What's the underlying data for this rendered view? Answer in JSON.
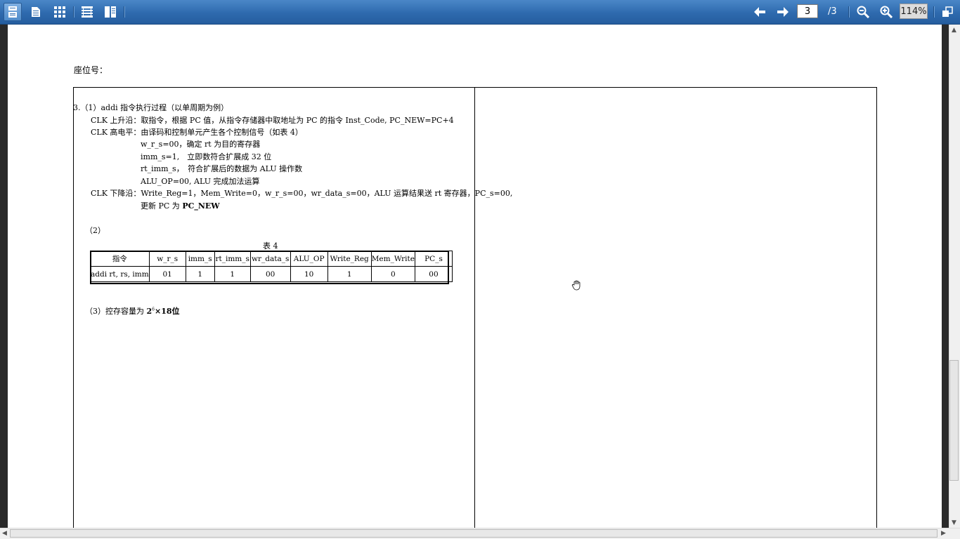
{
  "toolbar": {
    "page_current": "3",
    "page_total": "/3",
    "zoom": "114%",
    "icons": [
      "single-page-view-icon",
      "document-icon",
      "thumbnails-grid-icon",
      "book-view-icon",
      "two-page-view-icon",
      "previous-page-icon",
      "next-page-icon",
      "zoom-out-icon",
      "zoom-in-icon",
      "fit-page-icon"
    ]
  },
  "document": {
    "seat_label": "座位号：",
    "q3_1_heading": "3.（1）addi 指令执行过程（以单周期为例）",
    "clk_rise": "CLK 上升沿：取指令，根据 PC 值，从指令存储器中取地址为 PC 的指令 Inst_Code, PC_NEW=PC+4",
    "clk_high": "CLK 高电平：由译码和控制单元产生各个控制信号（如表 4）",
    "sig_wrs": "w_r_s=00，确定 rt 为目的寄存器",
    "sig_imms": "imm_s=1,　立即数符合扩展成 32 位",
    "sig_rtimms": "rt_imm_s，　符合扩展后的数据为 ALU 操作数",
    "sig_aluop": "ALU_OP=00, ALU 完成加法运算",
    "clk_fall": "CLK 下降沿：Write_Reg=1，Mem_Write=0，w_r_s=00，wr_data_s=00，ALU 运算结果送 rt 寄存器，PC_s=00,",
    "clk_fall_2": "更新 PC 为 ",
    "clk_fall_2_bold": "PC_NEW",
    "q3_2": "（2）",
    "table_caption": "表 4",
    "table_headers": [
      "指令",
      "w_r_s",
      "imm_s",
      "rt_imm_s",
      "wr_data_s",
      "ALU_OP",
      "Write_Reg",
      "Mem_Write",
      "PC_s"
    ],
    "table_row": [
      "addi rt, rs, imm",
      "01",
      "1",
      "1",
      "00",
      "10",
      "1",
      "0",
      "00"
    ],
    "q3_3_prefix": "（3）控存容量为 ",
    "q3_3_base": "2",
    "q3_3_exp": "6",
    "q3_3_suffix": "×18位"
  }
}
